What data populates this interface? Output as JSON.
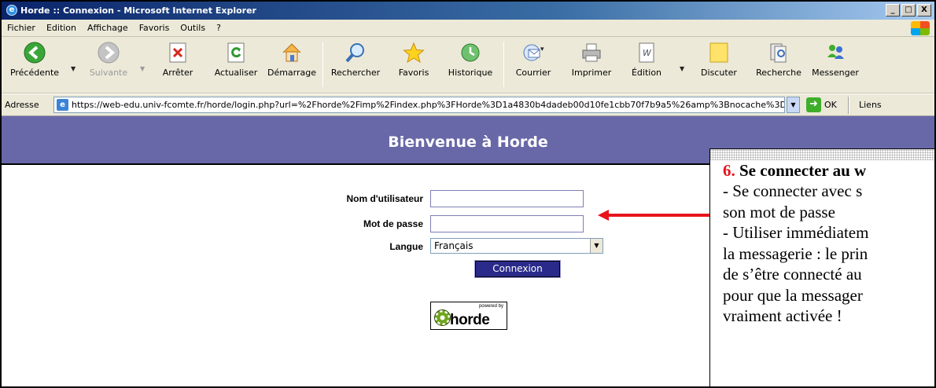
{
  "window": {
    "title": "Horde :: Connexion - Microsoft Internet Explorer",
    "controls": [
      "_",
      "□",
      "X"
    ]
  },
  "menubar": {
    "items": [
      "Fichier",
      "Edition",
      "Affichage",
      "Favoris",
      "Outils",
      "?"
    ]
  },
  "toolbar": {
    "back": "Précédente",
    "forward": "Suivante",
    "stop": "Arrêter",
    "refresh": "Actualiser",
    "home": "Démarrage",
    "search": "Rechercher",
    "favorites": "Favoris",
    "history": "Historique",
    "mail": "Courrier",
    "print": "Imprimer",
    "edit": "Édition",
    "discuss": "Discuter",
    "research": "Recherche",
    "messenger": "Messenger"
  },
  "addressbar": {
    "label": "Adresse",
    "url": "https://web-edu.univ-fcomte.fr/horde/login.php?url=%2Fhorde%2Fimp%2Findex.php%3FHorde%3D1a4830b4dadeb00d10fe1cbb70f7b9a5%26amp%3Bnocache%3D",
    "go_label": "OK",
    "links_label": "Liens"
  },
  "page": {
    "banner": "Bienvenue à Horde",
    "username_label": "Nom d'utilisateur",
    "username_value": "",
    "password_label": "Mot de passe",
    "password_value": "",
    "language_label": "Langue",
    "language_value": "Français",
    "submit_label": "Connexion",
    "logo_powered": "powered by",
    "logo_word": "horde"
  },
  "annotation": {
    "number": "6.",
    "heading": " Se connecter au w",
    "lines": [
      "- Se connecter avec s",
      "son mot de passe",
      "- Utiliser immédiatem",
      "la messagerie : le prin",
      "de s’être connecté au",
      "pour que la messager",
      "vraiment activée !"
    ],
    "accent_color": "#e8141c",
    "arrow_color": "#e8141c"
  }
}
